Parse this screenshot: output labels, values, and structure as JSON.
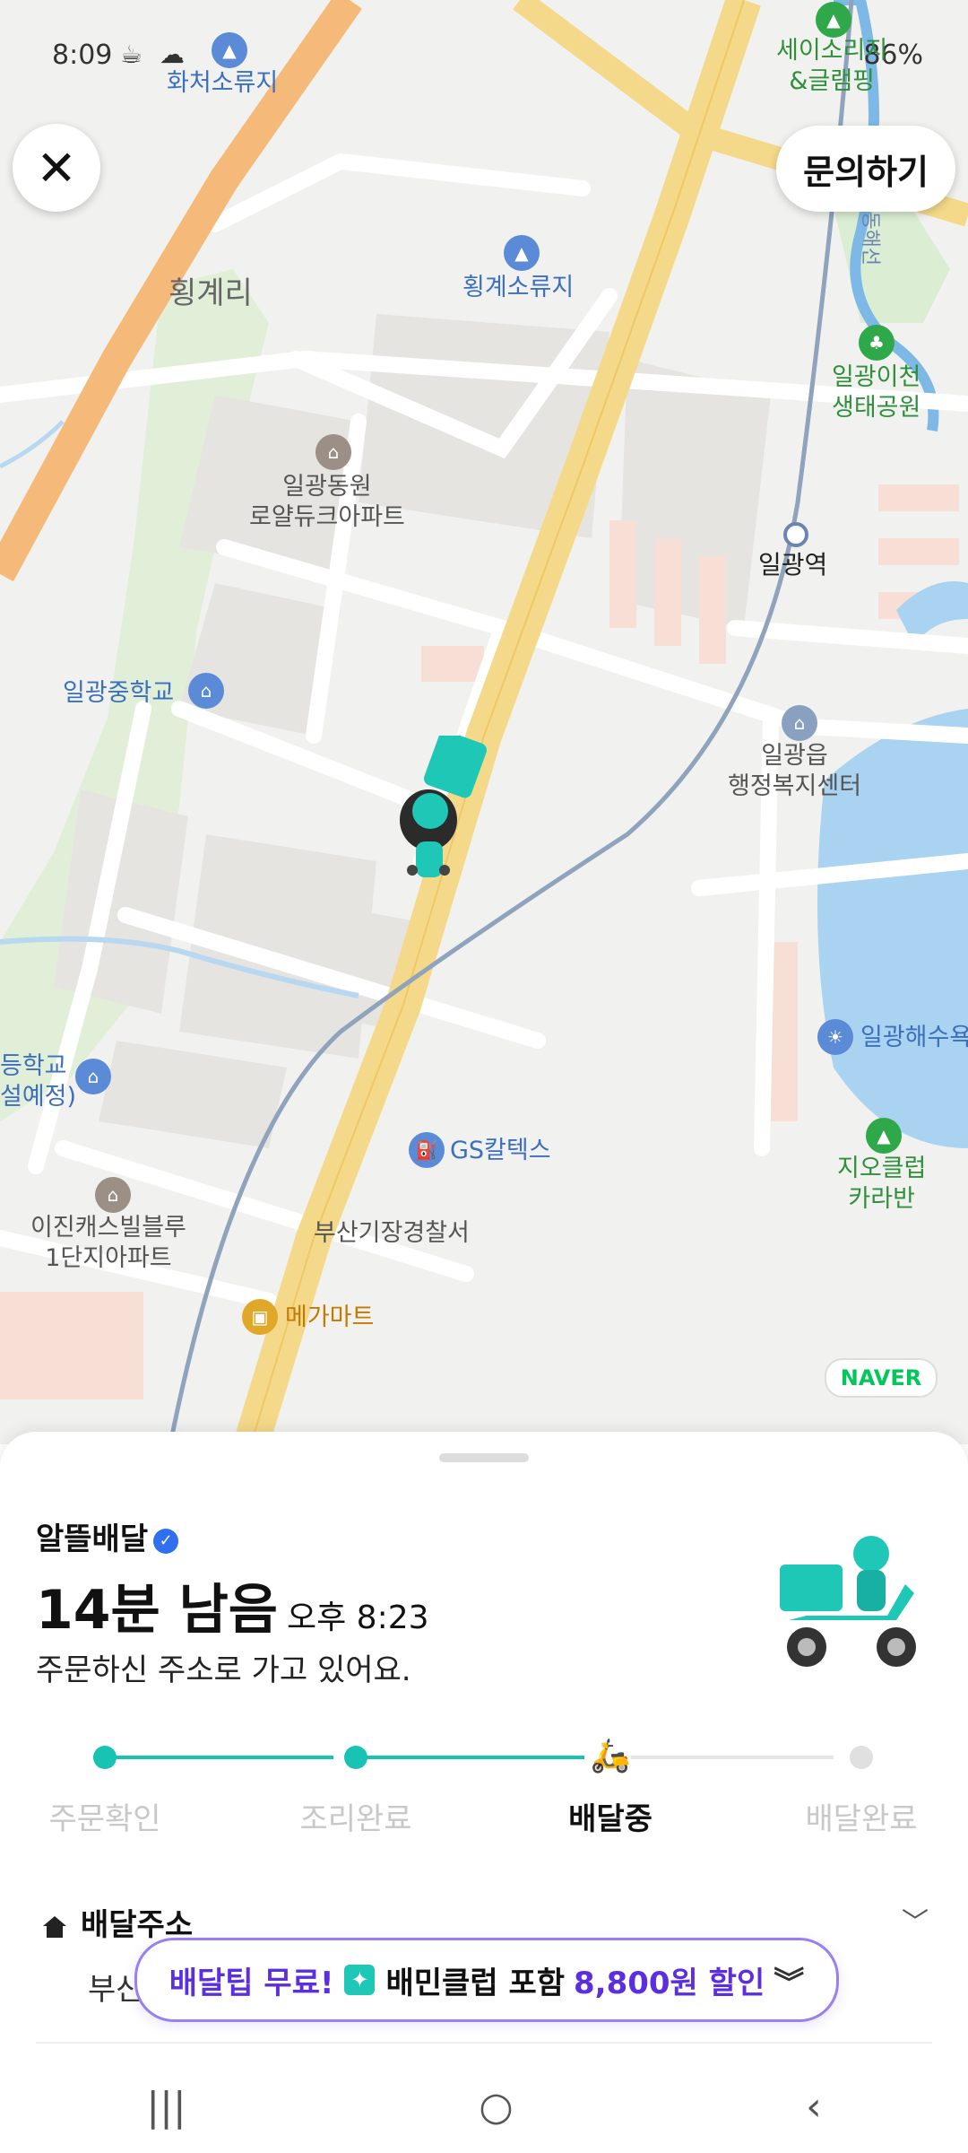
{
  "status_bar": {
    "time": "8:09",
    "battery": "86%"
  },
  "map": {
    "inquiry_label": "문의하기",
    "labels": {
      "hwacheo": "화처소류지",
      "hoengye_ri": "횡계리",
      "hoengye_pond": "횡계소류지",
      "ilgwang_dongwon": "일광동원\n로얄듀크아파트",
      "ilgwang_middle": "일광중학교",
      "ilgwang_station": "일광역",
      "ilgwang_eup": "일광읍\n행정복지센터",
      "ilgwang_ecopark": "일광이천\n생태공원",
      "camping": "세이소리지\n&글램핑",
      "donghae_line": "동해선",
      "school_left": "등학교\n설예정)",
      "beach": "일광해수욕",
      "gs": "GS칼텍스",
      "police": "부산기장경찰서",
      "ijin": "이진캐스빌블루\n1단지아파트",
      "megamart": "메가마트",
      "jio": "지오클럽\n카라반"
    },
    "naver": "NAVER"
  },
  "sheet": {
    "service": "알뜰배달",
    "eta_big": "14분 남음",
    "eta_time": "오후 8:23",
    "message": "주문하신 주소로 가고 있어요.",
    "steps": [
      "주문확인",
      "조리완료",
      "배달중",
      "배달완료"
    ],
    "address_header": "배달주소",
    "address_partial": "부산",
    "promo": {
      "part1": "배달팁 무료!",
      "part2": "배민클럽 포함",
      "part3": "8,800원 할인"
    }
  },
  "colors": {
    "accent": "#18c3b3",
    "promo": "#5b2fe0",
    "road_main": "#f5d98a"
  }
}
